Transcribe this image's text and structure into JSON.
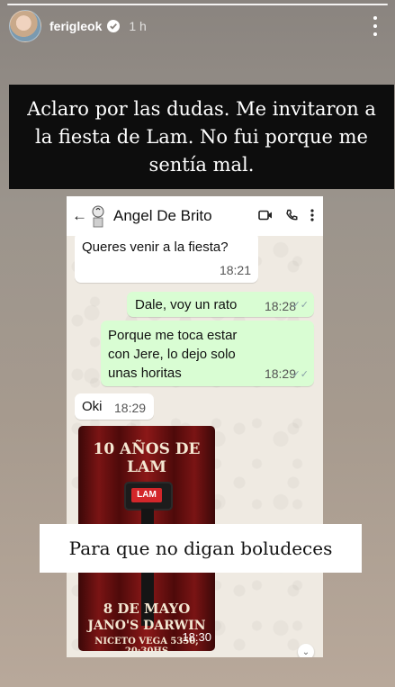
{
  "story": {
    "username": "ferigleok",
    "time_ago": "1 h"
  },
  "caption": {
    "text": "Aclaro por las dudas. Me invitaron a la fiesta de Lam. No fui porque me sentía mal."
  },
  "chat": {
    "contact_name": "Angel De Brito",
    "messages": [
      {
        "direction": "in",
        "text": "Queres venir a la fiesta?",
        "time": "18:21"
      },
      {
        "direction": "out",
        "text": "Dale, voy un rato",
        "time": "18:28"
      },
      {
        "direction": "out",
        "text": "Porque me toca estar con Jere, lo dejo solo unas horitas",
        "time": "18:29"
      },
      {
        "direction": "in",
        "text": "Oki",
        "time": "18:29"
      }
    ],
    "poster": {
      "title": "10 AÑOS DE LAM",
      "mic_label": "LAM",
      "date": "8 DE MAYO",
      "venue": "JANO'S DARWIN",
      "address": "NICETO VEGA 5350, 20:30HS",
      "time": "18:30"
    }
  },
  "sticker": {
    "text": "Para que no digan boludeces"
  },
  "colors": {
    "caption_bg": "#0d0d0d",
    "outgoing_bubble": "#d9fdd3",
    "incoming_bubble": "#ffffff",
    "chat_bg": "#efeae2"
  },
  "icons": [
    "verified-icon",
    "more-options-icon",
    "back-arrow-icon",
    "video-call-icon",
    "phone-icon",
    "menu-icon",
    "read-ticks-icon",
    "scroll-down-icon"
  ]
}
